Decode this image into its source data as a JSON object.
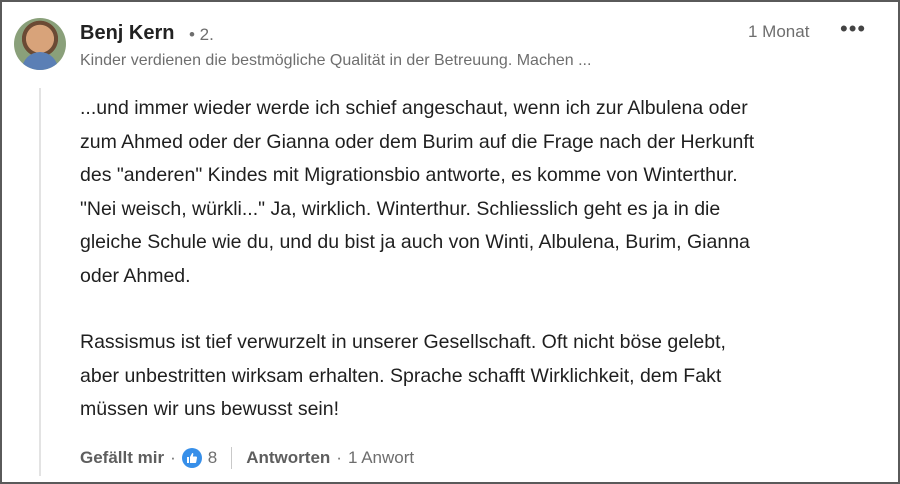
{
  "comment": {
    "author": "Benj Kern",
    "degree": "• 2.",
    "headline": "Kinder verdienen die bestmögliche Qualität in der Betreuung. Machen ...",
    "time": "1 Monat",
    "more_label": "•••",
    "paragraph1": [
      "...und immer wieder werde ich schief angeschaut, wenn ich zur Albulena oder",
      "zum Ahmed oder der Gianna oder dem Burim auf die Frage nach der Herkunft",
      "des \"anderen\" Kindes mit Migrationsbio antworte, es komme von Winterthur.",
      "\"Nei weisch, würkli...\" Ja, wirklich. Winterthur. Schliesslich geht es ja in die",
      "gleiche Schule wie du, und du bist ja auch von Winti, Albulena, Burim, Gianna",
      "oder Ahmed."
    ],
    "paragraph2": [
      "Rassismus ist tief verwurzelt in unserer Gesellschaft. Oft nicht böse gelebt,",
      "aber unbestritten wirksam erhalten. Sprache schafft Wirklichkeit, dem Fakt",
      "müssen wir uns bewusst sein!"
    ]
  },
  "actions": {
    "like_label": "Gefällt mir",
    "separator_dot": "·",
    "like_icon": "thumbs-up-icon",
    "like_count": "8",
    "reply_label": "Antworten",
    "reply_count": "1 Anwort"
  },
  "colors": {
    "like_blue": "#378fe9",
    "muted_text": "#6e6e6e"
  }
}
